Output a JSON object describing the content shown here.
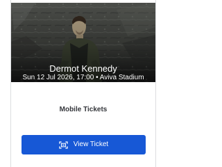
{
  "event": {
    "artist": "Dermot Kennedy",
    "date_time_venue": "Sun 12 Jul 2026, 17:00 • Aviva Stadium"
  },
  "ticket": {
    "type_label": "Mobile Tickets",
    "view_button_label": "View Ticket",
    "view_button_icon": "ticket-scan-icon"
  },
  "colors": {
    "accent": "#f07a28",
    "button": "#1758d6",
    "text": "#34363b"
  }
}
